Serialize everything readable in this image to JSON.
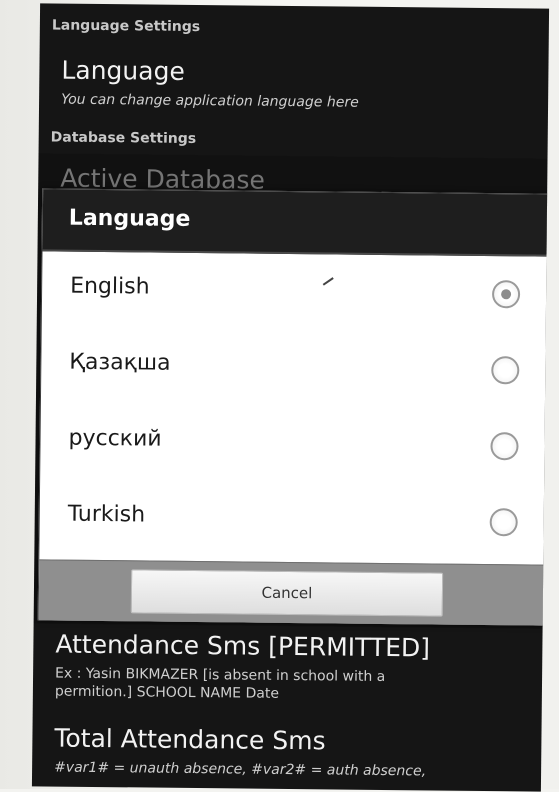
{
  "settings": {
    "language_category": "Language Settings",
    "language_title": "Language",
    "language_summary": "You can change application language here",
    "database_category": "Database Settings",
    "active_database_title": "Active Database",
    "attendance_permitted_title": "Attendance Sms [PERMITTED]",
    "attendance_permitted_summary_1": "Ex : Yasin BIKMAZER [is absent in school with a",
    "attendance_permitted_summary_2": "permition.] SCHOOL NAME Date",
    "total_attendance_title": "Total Attendance Sms",
    "total_attendance_summary": "#var1# = unauth absence, #var2# = auth absence,"
  },
  "dialog": {
    "title": "Language",
    "options": [
      {
        "label": "English",
        "selected": true
      },
      {
        "label": "Қазақша",
        "selected": false
      },
      {
        "label": "русский",
        "selected": false
      },
      {
        "label": "Turkish",
        "selected": false
      }
    ],
    "cancel_label": "Cancel"
  },
  "colors": {
    "screen_bg": "#151515",
    "dialog_bg": "#ffffff",
    "footer_bg": "#8f8f8f"
  }
}
